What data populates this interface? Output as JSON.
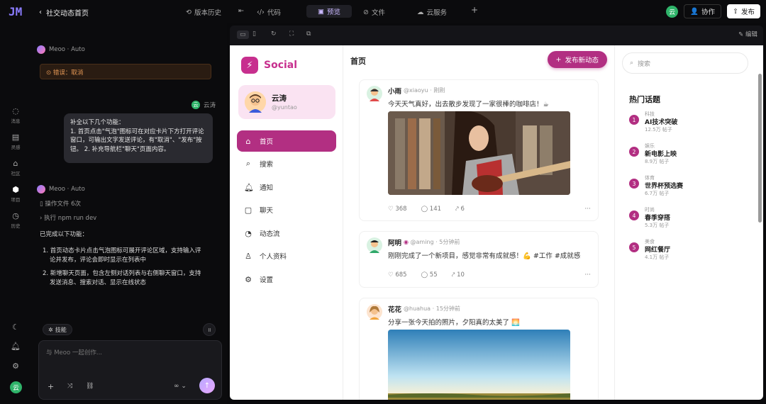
{
  "topbar": {
    "logo": "JM",
    "back_label": "社交动态首页",
    "history": "版本历史",
    "code": "代码",
    "preview": "预览",
    "files": "文件",
    "cloud": "云服务",
    "user_initial": "云",
    "collab": "协作",
    "publish": "发布"
  },
  "rail": [
    {
      "label": "消息",
      "icon": "chat-icon"
    },
    {
      "label": "灵感",
      "icon": "bulb-icon"
    },
    {
      "label": "社区",
      "icon": "community-icon"
    },
    {
      "label": "项目",
      "icon": "cube-icon"
    },
    {
      "label": "历史",
      "icon": "clock-icon"
    }
  ],
  "chat": {
    "bot_name_1": "Meoo · Auto",
    "warning": "错误：取消",
    "user_name": "云涛",
    "user_bubble": [
      "补全以下几个功能：",
      "1. 首页点击\"气泡\"图标可在对应卡片下方打开评论",
      "窗口，可输出文字发送评论，有\"取消\"、\"发布\"按",
      "钮。 2. 补充导航栏\"聊天\"页面内容。"
    ],
    "bot_name_2": "Meoo · Auto",
    "tool_1": "操作文件 6次",
    "tool_2": "执行 npm run dev",
    "intro": "已完成以下功能：",
    "points": [
      [
        "1. 首页动态卡片点击气泡图标可展开评论区域，支持输入评",
        "论并发布，评论会即时显示在列表中"
      ],
      [
        "2. 新增聊天页面，包含左侧对话列表与右侧聊天窗口，支持",
        "发送消息、搜索对话、显示在线状态"
      ]
    ],
    "skill": "技能",
    "placeholder": "与 Meoo 一起创作..."
  },
  "preview_bar": {
    "edit": "编辑"
  },
  "site": {
    "brand": "Social",
    "user": {
      "name": "云涛",
      "handle": "@yuntao"
    },
    "nav": [
      {
        "label": "首页",
        "icon": "home-icon"
      },
      {
        "label": "搜索",
        "icon": "search-icon"
      },
      {
        "label": "通知",
        "icon": "bell-icon"
      },
      {
        "label": "聊天",
        "icon": "chat-icon"
      },
      {
        "label": "动态流",
        "icon": "rss-icon"
      },
      {
        "label": "个人资料",
        "icon": "person-icon"
      },
      {
        "label": "设置",
        "icon": "gear-icon"
      }
    ],
    "feed_title": "首页",
    "new_post": "发布新动态",
    "posts": [
      {
        "name": "小雨",
        "handle": "@xiaoyu",
        "time": "刚刚",
        "text": "今天天气真好，出去散步发现了一家很棒的咖啡店！☕",
        "likes": "368",
        "comments": "141",
        "shares": "6"
      },
      {
        "name": "阿明",
        "handle": "@aming",
        "time": "5分钟前",
        "text": "刚刚完成了一个新项目，感觉非常有成就感！💪 #工作 #成就感",
        "likes": "685",
        "comments": "55",
        "shares": "10"
      },
      {
        "name": "花花",
        "handle": "@huahua",
        "time": "15分钟前",
        "text": "分享一张今天拍的照片，夕阳真的太美了 🌅"
      }
    ],
    "search_placeholder": "搜索",
    "hot_title": "热门话题",
    "topics": [
      {
        "num": "1",
        "cat": "科技",
        "title": "AI技术突破",
        "count": "12.5万 帖子"
      },
      {
        "num": "2",
        "cat": "娱乐",
        "title": "新电影上映",
        "count": "8.9万 帖子"
      },
      {
        "num": "3",
        "cat": "体育",
        "title": "世界杯预选赛",
        "count": "6.7万 帖子"
      },
      {
        "num": "4",
        "cat": "时尚",
        "title": "春季穿搭",
        "count": "5.3万 帖子"
      },
      {
        "num": "5",
        "cat": "美食",
        "title": "网红餐厅",
        "count": "4.1万 帖子"
      }
    ]
  },
  "colors": {
    "brand": "#c72f8e",
    "accent_dark": "#b22f82",
    "bot_purple": "#8b7cff"
  }
}
